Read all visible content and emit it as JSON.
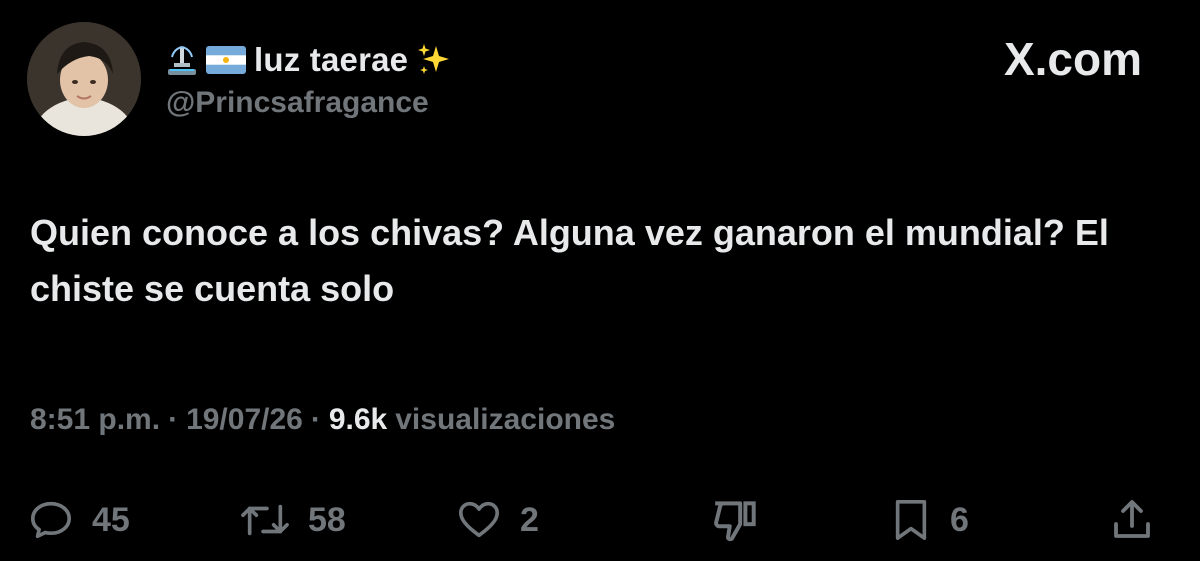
{
  "author": {
    "display_name": "luz taerae",
    "handle": "@Princsafragance",
    "name_emojis": [
      "fountain",
      "argentina-flag",
      "sparkles"
    ]
  },
  "brand": {
    "label": "X.com"
  },
  "tweet": {
    "text": "Quien conoce a los chivas? Alguna vez ganaron el mundial? El chiste se cuenta solo"
  },
  "meta": {
    "time": "8:51 p.m.",
    "separator": "·",
    "date": "19/07/26",
    "views_count": "9.6k",
    "views_label": "visualizaciones"
  },
  "actions": {
    "replies": "45",
    "reposts": "58",
    "likes": "2",
    "bookmarks": "6"
  },
  "colors": {
    "background": "#000000",
    "text_primary": "#e7e9ea",
    "text_secondary": "#71767b"
  }
}
